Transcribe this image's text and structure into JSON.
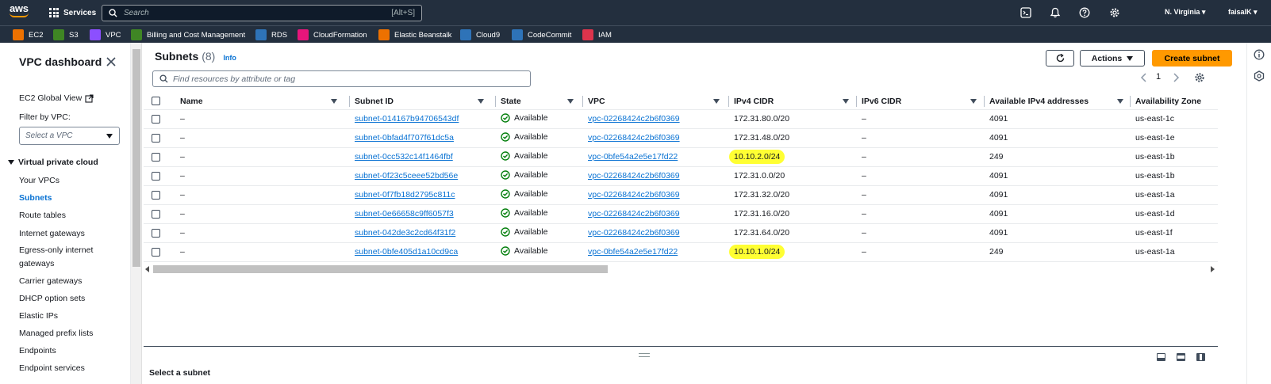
{
  "topnav": {
    "logo": "aws",
    "services_label": "Services",
    "search_placeholder": "Search",
    "search_shortcut": "[Alt+S]",
    "region": "N. Virginia ▾",
    "user": "faisalK ▾"
  },
  "favorites": [
    {
      "label": "EC2",
      "color": "#ed7100"
    },
    {
      "label": "S3",
      "color": "#3f8624"
    },
    {
      "label": "VPC",
      "color": "#8c4fff"
    },
    {
      "label": "Billing and Cost Management",
      "color": "#3f8624"
    },
    {
      "label": "RDS",
      "color": "#2e73b8"
    },
    {
      "label": "CloudFormation",
      "color": "#e7157b"
    },
    {
      "label": "Elastic Beanstalk",
      "color": "#ed7100"
    },
    {
      "label": "Cloud9",
      "color": "#2e73b8"
    },
    {
      "label": "CodeCommit",
      "color": "#2e73b8"
    },
    {
      "label": "IAM",
      "color": "#dd344c"
    }
  ],
  "sidebar": {
    "title": "VPC dashboard",
    "global_view": "EC2 Global View",
    "filter_label": "Filter by VPC:",
    "filter_placeholder": "Select a VPC",
    "section": "Virtual private cloud",
    "items": [
      "Your VPCs",
      "Subnets",
      "Route tables",
      "Internet gateways",
      "Egress-only internet",
      "gateways",
      "Carrier gateways",
      "DHCP option sets",
      "Elastic IPs",
      "Managed prefix lists",
      "Endpoints",
      "Endpoint services"
    ]
  },
  "main": {
    "title": "Subnets",
    "count": "(8)",
    "info": "Info",
    "actions_label": "Actions",
    "create_label": "Create subnet",
    "filter_placeholder": "Find resources by attribute or tag",
    "page": "1",
    "columns": [
      "Name",
      "Subnet ID",
      "State",
      "VPC",
      "IPv4 CIDR",
      "IPv6 CIDR",
      "Available IPv4 addresses",
      "Availability Zone"
    ],
    "rows": [
      {
        "name": "–",
        "subnet": "subnet-014167b94706543df",
        "state": "Available",
        "vpc": "vpc-02268424c2b6f0369",
        "cidr": "172.31.80.0/20",
        "ipv6": "–",
        "avail": "4091",
        "az": "us-east-1c"
      },
      {
        "name": "–",
        "subnet": "subnet-0bfad4f707f61dc5a",
        "state": "Available",
        "vpc": "vpc-02268424c2b6f0369",
        "cidr": "172.31.48.0/20",
        "ipv6": "–",
        "avail": "4091",
        "az": "us-east-1e"
      },
      {
        "name": "–",
        "subnet": "subnet-0cc532c14f1464fbf",
        "state": "Available",
        "vpc": "vpc-0bfe54a2e5e17fd22",
        "cidr": "10.10.2.0/24",
        "ipv6": "–",
        "avail": "249",
        "az": "us-east-1b"
      },
      {
        "name": "–",
        "subnet": "subnet-0f23c5ceee52bd56e",
        "state": "Available",
        "vpc": "vpc-02268424c2b6f0369",
        "cidr": "172.31.0.0/20",
        "ipv6": "–",
        "avail": "4091",
        "az": "us-east-1b"
      },
      {
        "name": "–",
        "subnet": "subnet-0f7fb18d2795c811c",
        "state": "Available",
        "vpc": "vpc-02268424c2b6f0369",
        "cidr": "172.31.32.0/20",
        "ipv6": "–",
        "avail": "4091",
        "az": "us-east-1a"
      },
      {
        "name": "–",
        "subnet": "subnet-0e66658c9ff6057f3",
        "state": "Available",
        "vpc": "vpc-02268424c2b6f0369",
        "cidr": "172.31.16.0/20",
        "ipv6": "–",
        "avail": "4091",
        "az": "us-east-1d"
      },
      {
        "name": "–",
        "subnet": "subnet-042de3c2cd64f31f2",
        "state": "Available",
        "vpc": "vpc-02268424c2b6f0369",
        "cidr": "172.31.64.0/20",
        "ipv6": "–",
        "avail": "4091",
        "az": "us-east-1f"
      },
      {
        "name": "–",
        "subnet": "subnet-0bfe405d1a10cd9ca",
        "state": "Available",
        "vpc": "vpc-0bfe54a2e5e17fd22",
        "cidr": "10.10.1.0/24",
        "ipv6": "–",
        "avail": "249",
        "az": "us-east-1a"
      }
    ],
    "select_hint": "Select a subnet"
  },
  "colors": {
    "accent": "#0972d3",
    "primary_button": "#ff9900",
    "highlight": "#ffff33",
    "topnav": "#232f3e",
    "available": "#037f0c"
  }
}
